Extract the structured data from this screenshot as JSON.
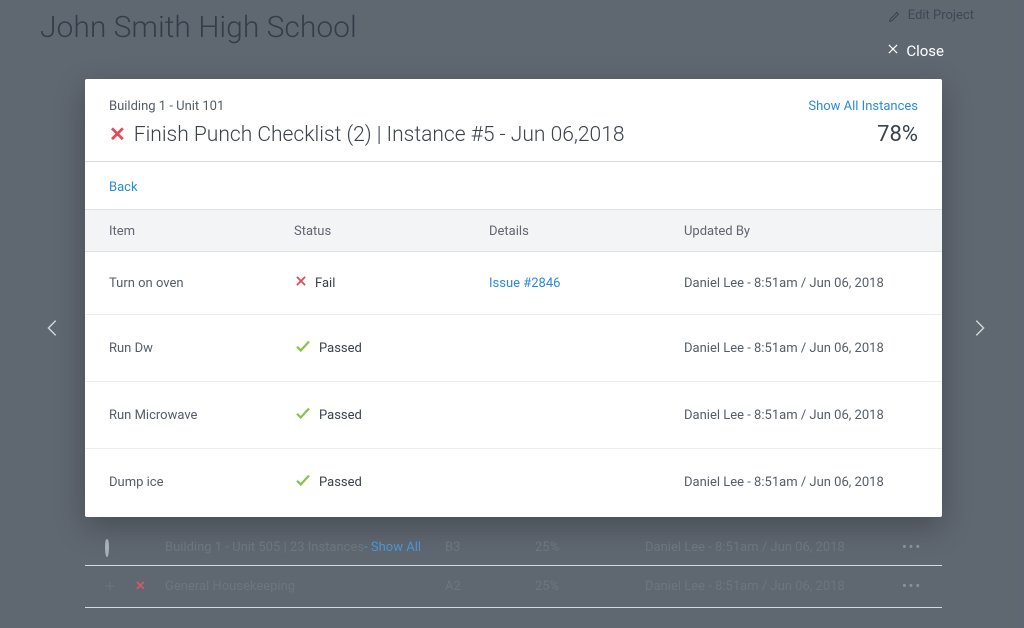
{
  "background": {
    "page_title": "John Smith High School",
    "edit_label": "Edit Project",
    "rows": [
      {
        "icon": "loader",
        "name": "Building 1 - Unit 505 | 23 Instances",
        "show_all": " - Show All",
        "code": "B3",
        "pct": "25%",
        "updated": "Daniel Lee - 8:51am / Jun 06, 2018"
      },
      {
        "icon": "plus-x",
        "name": "General Housekeeping",
        "show_all": "",
        "code": "A2",
        "pct": "25%",
        "updated": "Daniel Lee - 8:51am / Jun 06, 2018"
      }
    ]
  },
  "modal": {
    "close_label": "Close",
    "breadcrumb": "Building 1 - Unit 101",
    "title": "Finish Punch Checklist (2)   |   Instance #5 - Jun 06,2018",
    "percent": "78%",
    "show_all_label": "Show All Instances",
    "back_label": "Back",
    "columns": {
      "item": "Item",
      "status": "Status",
      "details": "Details",
      "updated": "Updated By"
    },
    "rows": [
      {
        "item": "Turn on oven",
        "status": "Fail",
        "status_kind": "fail",
        "details": "Issue #2846",
        "details_link": true,
        "updated": "Daniel Lee - 8:51am / Jun 06, 2018"
      },
      {
        "item": "Run Dw",
        "status": "Passed",
        "status_kind": "pass",
        "details": "",
        "details_link": false,
        "updated": "Daniel Lee - 8:51am / Jun 06, 2018"
      },
      {
        "item": "Run Microwave",
        "status": "Passed",
        "status_kind": "pass",
        "details": "",
        "details_link": false,
        "updated": "Daniel Lee - 8:51am / Jun 06, 2018"
      },
      {
        "item": "Dump ice",
        "status": "Passed",
        "status_kind": "pass",
        "details": "",
        "details_link": false,
        "updated": "Daniel Lee - 8:51am / Jun 06, 2018"
      }
    ]
  }
}
